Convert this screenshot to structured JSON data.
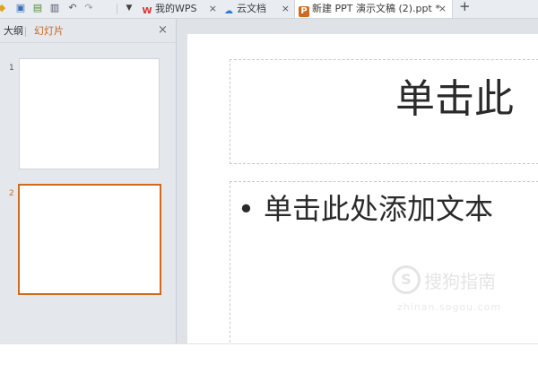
{
  "quick_access": {
    "icons": [
      "open-folder-icon",
      "save-icon",
      "print-preview-icon",
      "print-icon",
      "undo-icon",
      "redo-icon"
    ]
  },
  "tabs": [
    {
      "label": "我的WPS",
      "icon": "W",
      "close": "×"
    },
    {
      "label": "云文档",
      "icon": "☁",
      "close": "×"
    },
    {
      "label": "新建 PPT 演示文稿 (2).ppt *",
      "icon": "P",
      "close": "×"
    }
  ],
  "new_tab_label": "+",
  "dropdown_arrow": "▼",
  "side_panel": {
    "tab_outline": "大纲",
    "tab_slides": "幻灯片",
    "close": "×",
    "slides": [
      {
        "number": "1",
        "selected": false
      },
      {
        "number": "2",
        "selected": true
      }
    ]
  },
  "slide": {
    "title_placeholder": "单击此",
    "bullet": "•",
    "body_placeholder": "单击此处添加文本"
  },
  "watermark": {
    "text": "搜狗指南",
    "url": "zhinan.sogou.com"
  },
  "colors": {
    "accent": "#d06a1f",
    "wps_red": "#d9342b",
    "cloud_blue": "#2f7bd9"
  }
}
